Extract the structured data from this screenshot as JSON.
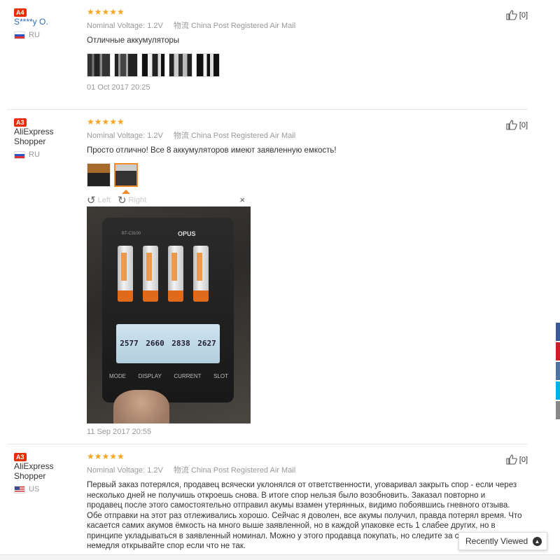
{
  "reviews": [
    {
      "level": "A4",
      "username": "S****y O.",
      "country": "RU",
      "stars": "★★★★★",
      "voltage": "Nominal Voltage: 1.2V",
      "shipping": "物流 China Post Registered Air Mail",
      "text": "Отличные аккумуляторы",
      "date": "01 Oct 2017 20:25",
      "helpful_count": "[0]"
    },
    {
      "level": "A3",
      "username": "AliExpress Shopper",
      "country": "RU",
      "stars": "★★★★★",
      "voltage": "Nominal Voltage: 1.2V",
      "shipping": "物流 China Post Registered Air Mail",
      "text": "Просто отлично! Все 8 аккумуляторов имеют заявленную емкость!",
      "date": "11 Sep 2017 20:55",
      "helpful_count": "[0]",
      "viewer": {
        "left_label": "Left",
        "right_label": "Right",
        "close": "×",
        "photo": {
          "brand": "OPUS",
          "model": "BT-C3100",
          "lcd_values": [
            "2577",
            "2660",
            "2838",
            "2627"
          ],
          "buttons": [
            "MODE",
            "DISPLAY",
            "CURRENT",
            "SLOT"
          ]
        }
      }
    },
    {
      "level": "A3",
      "username": "AliExpress Shopper",
      "country": "US",
      "stars": "★★★★★",
      "voltage": "Nominal Voltage: 1.2V",
      "shipping": "物流 China Post Registered Air Mail",
      "text": "Первый заказ потерялся, продавец всячески уклонялся от ответственности, уговаривал закрыть спор - если через несколько дней не получишь откроешь снова. В итоге спор нельзя было возобновить. Заказал повторно и продавец после этого самостоятельно отправил акумы взамен утерянных, видимо побоявшись гневного отзыва. Обе отправки на этот раз отлеживались хорошо. Сейчас я доволен, все акумы получил, правда потерял время. Что касается самих акумов ёмкость на много выше заявленной, но в каждой упаковке есть 1 слабее других, но в принципе укладываться в заявленный номинал. Можно у этого продавца покупать, но следите за сроками и немедля открывайте спор если что не так.",
      "helpful_count": "[0]"
    }
  ],
  "recently_viewed": {
    "label": "Recently Viewed"
  },
  "share_colors": [
    "#3b5998",
    "#cb2027",
    "#4c75a3",
    "#00aced",
    "#888888"
  ]
}
